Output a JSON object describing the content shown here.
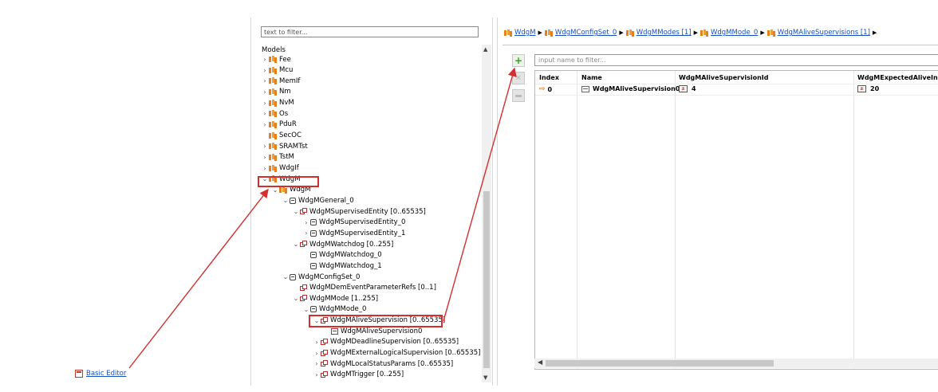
{
  "left_link": {
    "label": "Basic Editor",
    "icon": "basic-editor-icon"
  },
  "tree": {
    "filter_placeholder": "text to filter...",
    "title": "Models",
    "rows": [
      {
        "label": "Fee",
        "icon": "model-icon",
        "expander": ">"
      },
      {
        "label": "Mcu",
        "icon": "model-icon",
        "expander": ">"
      },
      {
        "label": "MemIf",
        "icon": "model-icon",
        "expander": ">"
      },
      {
        "label": "Nm",
        "icon": "model-icon",
        "expander": ">"
      },
      {
        "label": "NvM",
        "icon": "model-icon",
        "expander": ">"
      },
      {
        "label": "Os",
        "icon": "model-icon",
        "expander": ">"
      },
      {
        "label": "PduR",
        "icon": "model-icon",
        "expander": ">"
      },
      {
        "label": "SecOC",
        "icon": "model-icon",
        "expander": ""
      },
      {
        "label": "SRAMTst",
        "icon": "model-icon",
        "expander": ">"
      },
      {
        "label": "TstM",
        "icon": "model-icon",
        "expander": ">"
      },
      {
        "label": "WdgIf",
        "icon": "model-icon",
        "expander": ">"
      },
      {
        "label": "WdgM",
        "icon": "model-icon",
        "expander": "v",
        "highlighted": true
      },
      {
        "label": "WdgM",
        "icon": "model-icon",
        "expander": "v"
      },
      {
        "label": "WdgMGeneral_0",
        "icon": "container-icon",
        "expander": "v"
      },
      {
        "label": "WdgMSupervisedEntity [0..65535]",
        "icon": "list-icon",
        "expander": "v"
      },
      {
        "label": "WdgMSupervisedEntity_0",
        "icon": "container-icon",
        "expander": ">"
      },
      {
        "label": "WdgMSupervisedEntity_1",
        "icon": "container-icon",
        "expander": ">"
      },
      {
        "label": "WdgMWatchdog [0..255]",
        "icon": "list-icon",
        "expander": "v"
      },
      {
        "label": "WdgMWatchdog_0",
        "icon": "container-icon",
        "expander": ""
      },
      {
        "label": "WdgMWatchdog_1",
        "icon": "container-icon",
        "expander": ""
      },
      {
        "label": "WdgMConfigSet_0",
        "icon": "container-icon",
        "expander": "v"
      },
      {
        "label": "WdgMDemEventParameterRefs [0..1]",
        "icon": "list-icon",
        "expander": ""
      },
      {
        "label": "WdgMMode [1..255]",
        "icon": "list-icon",
        "expander": "v"
      },
      {
        "label": "WdgMMode_0",
        "icon": "container-icon",
        "expander": "v"
      },
      {
        "label": "WdgMAliveSupervision [0..65535]",
        "icon": "list-icon",
        "expander": "v",
        "highlighted": true
      },
      {
        "label": "WdgMAliveSupervision0",
        "icon": "container-red-icon",
        "expander": ""
      },
      {
        "label": "WdgMDeadlineSupervision [0..65535]",
        "icon": "list-icon",
        "expander": ">"
      },
      {
        "label": "WdgMExternalLogicalSupervision [0..65535]",
        "icon": "list-icon",
        "expander": ">"
      },
      {
        "label": "WdgMLocalStatusParams [0..65535]",
        "icon": "list-icon",
        "expander": ">"
      },
      {
        "label": "WdgMTrigger [0..255]",
        "icon": "list-icon",
        "expander": ">"
      }
    ]
  },
  "breadcrumb": {
    "items": [
      "WdgM",
      "WdgMConfigSet_0",
      "WdgMModes [1]",
      "WdgMMode_0",
      "WdgMAliveSupervisions [1]"
    ],
    "separator": "▶"
  },
  "toolbar": {
    "add_icon": "add-icon",
    "delete_icon": "delete-icon",
    "disabled_icon": "minus-icon"
  },
  "table": {
    "filter_placeholder": "input name to filter...",
    "columns": [
      "Index",
      "Name",
      "WdgMAliveSupervisionId",
      "WdgMExpectedAliveIn"
    ],
    "rows": [
      {
        "index": "0",
        "name": "WdgMAliveSupervision0",
        "id": "4",
        "expected": "20"
      }
    ]
  },
  "colors": {
    "highlight": "#d32f2f",
    "link": "#1a4fbf",
    "model_icon": "#e67e22"
  }
}
